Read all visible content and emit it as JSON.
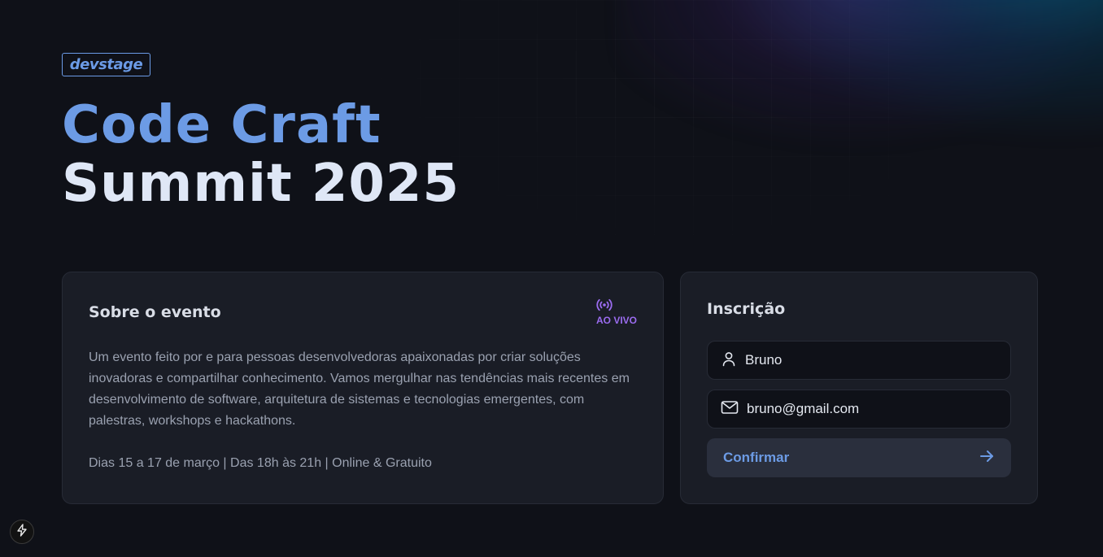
{
  "brand": {
    "logo_text": "devstage"
  },
  "hero": {
    "title_line1": "Code Craft",
    "title_line2": "Summit 2025"
  },
  "about": {
    "title": "Sobre o evento",
    "live_badge": "AO VIVO",
    "description": "Um evento feito por e para pessoas desenvolvedoras apaixonadas por criar soluções inovadoras e compartilhar conhecimento. Vamos mergulhar nas tendências mais recentes em desenvolvimento de software, arquitetura de sistemas e tecnologias emergentes, com palestras, workshops e hackathons.",
    "meta": "Dias 15 a 17 de março | Das 18h às 21h | Online & Gratuito"
  },
  "subscription": {
    "title": "Inscrição",
    "name_value": "Bruno",
    "email_value": "bruno@gmail.com",
    "confirm_label": "Confirmar"
  },
  "icons": {
    "live": "radio-broadcast-icon",
    "user": "user-icon",
    "email": "mail-icon",
    "arrow": "arrow-right-icon",
    "devtools": "lightning-bolt-icon"
  },
  "colors": {
    "accent_blue": "#6c9be5",
    "accent_purple": "#9b6cf0",
    "background": "#0f1118",
    "card": "#1a1d26"
  }
}
